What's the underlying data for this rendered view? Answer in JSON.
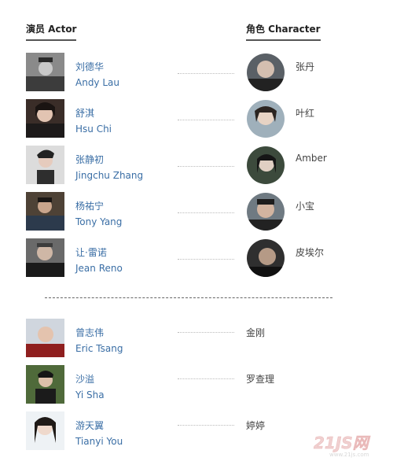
{
  "headers": {
    "actor": "演员 Actor",
    "character": "角色 Character"
  },
  "main_cast": [
    {
      "cn": "刘德华",
      "en": "Andy Lau",
      "role": "张丹"
    },
    {
      "cn": "舒淇",
      "en": "Hsu Chi",
      "role": "叶红"
    },
    {
      "cn": "张静初",
      "en": "Jingchu Zhang",
      "role": "Amber"
    },
    {
      "cn": "杨祐宁",
      "en": "Tony Yang",
      "role": "小宝"
    },
    {
      "cn": "让·雷诺",
      "en": "Jean Reno",
      "role": "皮埃尔"
    }
  ],
  "supporting_cast": [
    {
      "cn": "曾志伟",
      "en": "Eric Tsang",
      "role": "金刚"
    },
    {
      "cn": "沙溢",
      "en": "Yi Sha",
      "role": "罗查理"
    },
    {
      "cn": "游天翼",
      "en": "Tianyi You",
      "role": "婷婷"
    }
  ],
  "watermark": {
    "logo": "21JS网",
    "url": "www.21js.com"
  },
  "colors": {
    "link": "#3a6ea5",
    "header_rule": "#555555",
    "dotted": "#bbbbbb"
  }
}
